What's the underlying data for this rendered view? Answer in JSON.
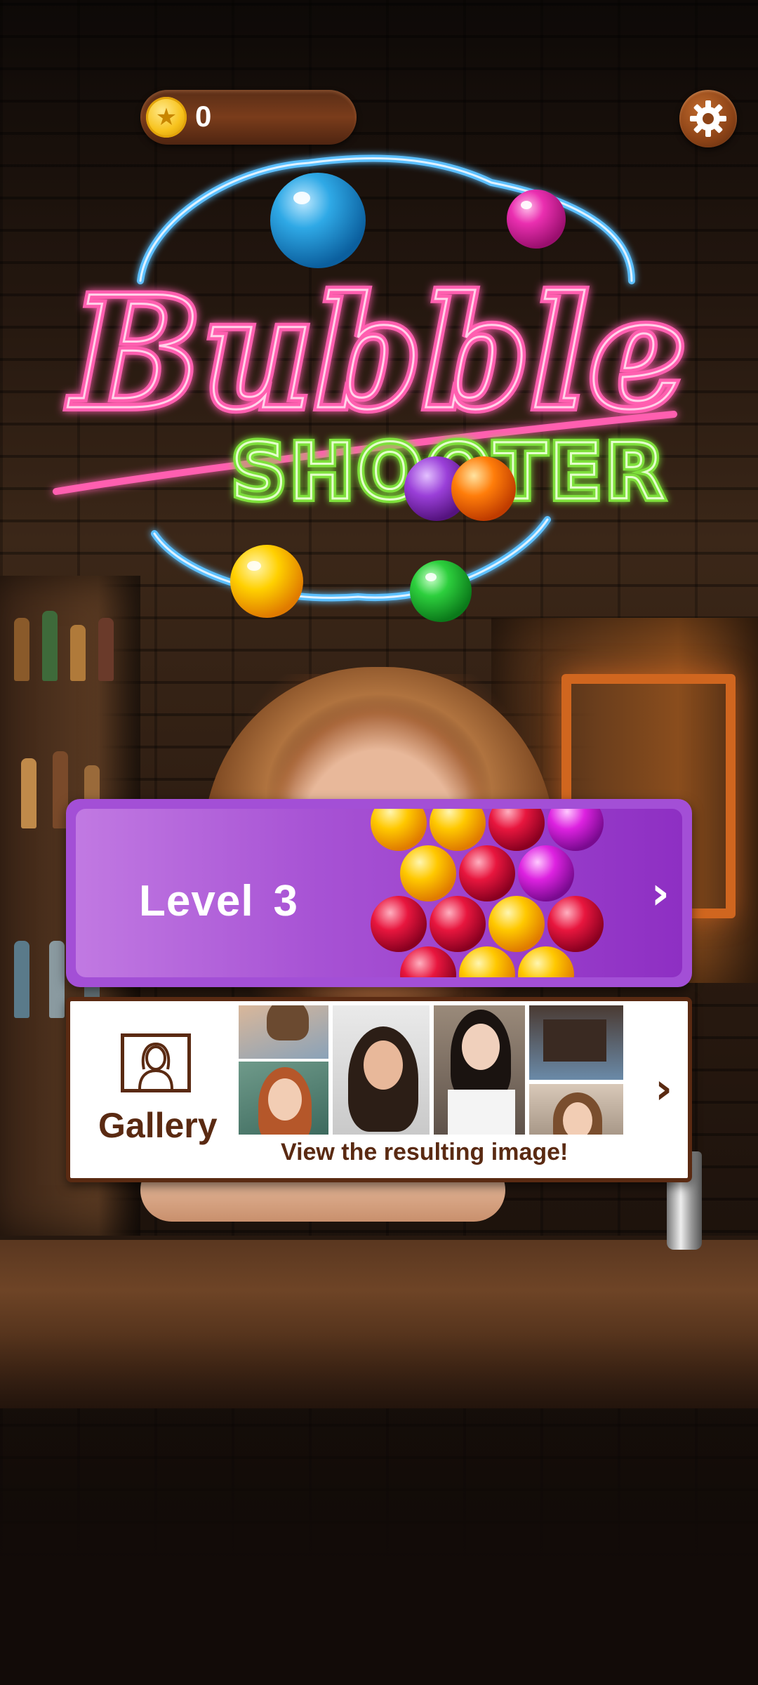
{
  "coins": {
    "count": "0"
  },
  "settings": {
    "icon": "gear-icon"
  },
  "logo": {
    "line1": "Bubble",
    "line2": "SHOOTER"
  },
  "level_card": {
    "label": "Level",
    "number": "3",
    "chevron": "›"
  },
  "gallery_card": {
    "label": "Gallery",
    "caption": "View the resulting image!",
    "chevron": "›"
  },
  "colors": {
    "neon_pink": "#ff5fb0",
    "neon_green": "#7ee03a",
    "neon_blue": "#3ca8ff",
    "level_purple": "#a34fd6",
    "gallery_brown": "#5a2a12",
    "coin_gold": "#f7c21c"
  }
}
